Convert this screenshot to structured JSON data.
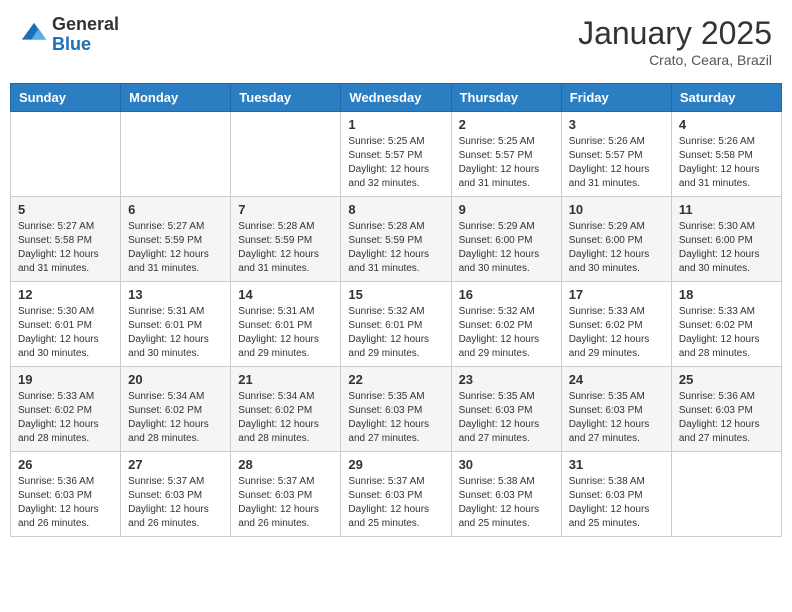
{
  "header": {
    "logo_general": "General",
    "logo_blue": "Blue",
    "month_title": "January 2025",
    "location": "Crato, Ceara, Brazil"
  },
  "weekdays": [
    "Sunday",
    "Monday",
    "Tuesday",
    "Wednesday",
    "Thursday",
    "Friday",
    "Saturday"
  ],
  "weeks": [
    [
      {
        "day": "",
        "info": ""
      },
      {
        "day": "",
        "info": ""
      },
      {
        "day": "",
        "info": ""
      },
      {
        "day": "1",
        "info": "Sunrise: 5:25 AM\nSunset: 5:57 PM\nDaylight: 12 hours\nand 32 minutes."
      },
      {
        "day": "2",
        "info": "Sunrise: 5:25 AM\nSunset: 5:57 PM\nDaylight: 12 hours\nand 31 minutes."
      },
      {
        "day": "3",
        "info": "Sunrise: 5:26 AM\nSunset: 5:57 PM\nDaylight: 12 hours\nand 31 minutes."
      },
      {
        "day": "4",
        "info": "Sunrise: 5:26 AM\nSunset: 5:58 PM\nDaylight: 12 hours\nand 31 minutes."
      }
    ],
    [
      {
        "day": "5",
        "info": "Sunrise: 5:27 AM\nSunset: 5:58 PM\nDaylight: 12 hours\nand 31 minutes."
      },
      {
        "day": "6",
        "info": "Sunrise: 5:27 AM\nSunset: 5:59 PM\nDaylight: 12 hours\nand 31 minutes."
      },
      {
        "day": "7",
        "info": "Sunrise: 5:28 AM\nSunset: 5:59 PM\nDaylight: 12 hours\nand 31 minutes."
      },
      {
        "day": "8",
        "info": "Sunrise: 5:28 AM\nSunset: 5:59 PM\nDaylight: 12 hours\nand 31 minutes."
      },
      {
        "day": "9",
        "info": "Sunrise: 5:29 AM\nSunset: 6:00 PM\nDaylight: 12 hours\nand 30 minutes."
      },
      {
        "day": "10",
        "info": "Sunrise: 5:29 AM\nSunset: 6:00 PM\nDaylight: 12 hours\nand 30 minutes."
      },
      {
        "day": "11",
        "info": "Sunrise: 5:30 AM\nSunset: 6:00 PM\nDaylight: 12 hours\nand 30 minutes."
      }
    ],
    [
      {
        "day": "12",
        "info": "Sunrise: 5:30 AM\nSunset: 6:01 PM\nDaylight: 12 hours\nand 30 minutes."
      },
      {
        "day": "13",
        "info": "Sunrise: 5:31 AM\nSunset: 6:01 PM\nDaylight: 12 hours\nand 30 minutes."
      },
      {
        "day": "14",
        "info": "Sunrise: 5:31 AM\nSunset: 6:01 PM\nDaylight: 12 hours\nand 29 minutes."
      },
      {
        "day": "15",
        "info": "Sunrise: 5:32 AM\nSunset: 6:01 PM\nDaylight: 12 hours\nand 29 minutes."
      },
      {
        "day": "16",
        "info": "Sunrise: 5:32 AM\nSunset: 6:02 PM\nDaylight: 12 hours\nand 29 minutes."
      },
      {
        "day": "17",
        "info": "Sunrise: 5:33 AM\nSunset: 6:02 PM\nDaylight: 12 hours\nand 29 minutes."
      },
      {
        "day": "18",
        "info": "Sunrise: 5:33 AM\nSunset: 6:02 PM\nDaylight: 12 hours\nand 28 minutes."
      }
    ],
    [
      {
        "day": "19",
        "info": "Sunrise: 5:33 AM\nSunset: 6:02 PM\nDaylight: 12 hours\nand 28 minutes."
      },
      {
        "day": "20",
        "info": "Sunrise: 5:34 AM\nSunset: 6:02 PM\nDaylight: 12 hours\nand 28 minutes."
      },
      {
        "day": "21",
        "info": "Sunrise: 5:34 AM\nSunset: 6:02 PM\nDaylight: 12 hours\nand 28 minutes."
      },
      {
        "day": "22",
        "info": "Sunrise: 5:35 AM\nSunset: 6:03 PM\nDaylight: 12 hours\nand 27 minutes."
      },
      {
        "day": "23",
        "info": "Sunrise: 5:35 AM\nSunset: 6:03 PM\nDaylight: 12 hours\nand 27 minutes."
      },
      {
        "day": "24",
        "info": "Sunrise: 5:35 AM\nSunset: 6:03 PM\nDaylight: 12 hours\nand 27 minutes."
      },
      {
        "day": "25",
        "info": "Sunrise: 5:36 AM\nSunset: 6:03 PM\nDaylight: 12 hours\nand 27 minutes."
      }
    ],
    [
      {
        "day": "26",
        "info": "Sunrise: 5:36 AM\nSunset: 6:03 PM\nDaylight: 12 hours\nand 26 minutes."
      },
      {
        "day": "27",
        "info": "Sunrise: 5:37 AM\nSunset: 6:03 PM\nDaylight: 12 hours\nand 26 minutes."
      },
      {
        "day": "28",
        "info": "Sunrise: 5:37 AM\nSunset: 6:03 PM\nDaylight: 12 hours\nand 26 minutes."
      },
      {
        "day": "29",
        "info": "Sunrise: 5:37 AM\nSunset: 6:03 PM\nDaylight: 12 hours\nand 25 minutes."
      },
      {
        "day": "30",
        "info": "Sunrise: 5:38 AM\nSunset: 6:03 PM\nDaylight: 12 hours\nand 25 minutes."
      },
      {
        "day": "31",
        "info": "Sunrise: 5:38 AM\nSunset: 6:03 PM\nDaylight: 12 hours\nand 25 minutes."
      },
      {
        "day": "",
        "info": ""
      }
    ]
  ]
}
